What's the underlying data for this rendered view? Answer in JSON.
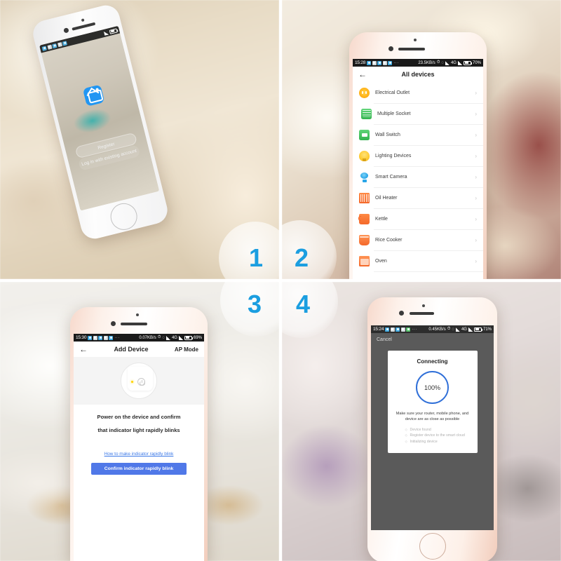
{
  "panels": [
    {
      "number": "1",
      "caption_number": "1",
      "app": {
        "logo_icon": "smart-home-app-icon",
        "logo_color": "#2196f3",
        "register_label": "Register",
        "login_label": "Log in with existing account"
      }
    },
    {
      "number": "2",
      "statusbar": {
        "time": "15:28",
        "net_speed": "23.5KB/s",
        "network": "4G",
        "battery": "70%"
      },
      "nav": {
        "back_icon": "back-arrow-icon",
        "title": "All devices"
      },
      "devices": [
        {
          "name": "Electrical Outlet",
          "icon": "electrical-outlet-icon",
          "color": "#ffb217"
        },
        {
          "name": "Multiple Socket",
          "icon": "multiple-socket-icon",
          "color": "#34b44f"
        },
        {
          "name": "Wall Switch",
          "icon": "wall-switch-icon",
          "color": "#33b24e"
        },
        {
          "name": "Lighting Devices",
          "icon": "light-bulb-icon",
          "color": "#ffcc33"
        },
        {
          "name": "Smart Camera",
          "icon": "smart-camera-icon",
          "color": "#2aa6e8"
        },
        {
          "name": "Oil Heater",
          "icon": "oil-heater-icon",
          "color": "#f4682a"
        },
        {
          "name": "Kettle",
          "icon": "kettle-icon",
          "color": "#f4682a"
        },
        {
          "name": "Rice Cooker",
          "icon": "rice-cooker-icon",
          "color": "#f4682a"
        },
        {
          "name": "Oven",
          "icon": "oven-icon",
          "color": "#f4682a"
        }
      ]
    },
    {
      "number": "3",
      "statusbar": {
        "time": "15:30",
        "net_speed": "0.07KB/s",
        "network": "4G",
        "battery": "69%"
      },
      "nav": {
        "back_icon": "back-arrow-icon",
        "title": "Add Device",
        "right_label": "AP Mode"
      },
      "hero": {
        "device_icon": "smart-plug-illustration",
        "power_icon": "power-icon",
        "led_color": "#ffd400"
      },
      "instruction_line1": "Power on the device and confirm",
      "instruction_line2": "that indicator light rapidly blinks",
      "help_link": "How to make indicator rapidly blink",
      "confirm_button": "Confirm indicator rapidly blink",
      "button_color": "#5078e8"
    },
    {
      "number": "4",
      "statusbar": {
        "time": "15:24",
        "net_speed": "0.45KB/s",
        "network": "4G",
        "battery": "71%"
      },
      "cancel_label": "Cancel",
      "dialog": {
        "title": "Connecting",
        "progress": "100%",
        "progress_color": "#2f6fd8",
        "hint": "Make sure your router, mobile phone, and device are as close as possible",
        "steps": [
          "Device found",
          "Register device to the smart cloud",
          "Initializing device"
        ]
      }
    }
  ],
  "badge_color": "#1b9ee0"
}
